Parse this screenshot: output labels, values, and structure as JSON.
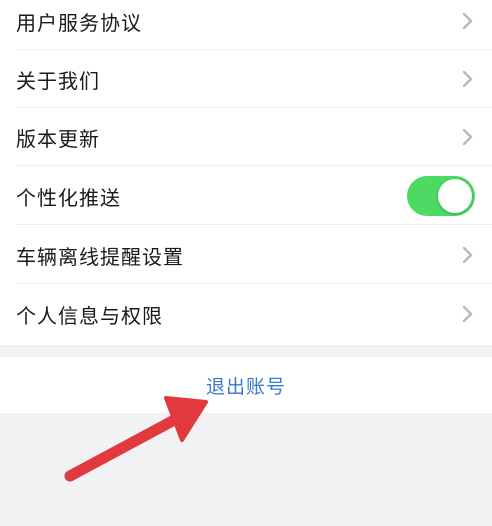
{
  "menu": {
    "items": [
      {
        "label": "用户服务协议",
        "control": "chevron"
      },
      {
        "label": "关于我们",
        "control": "chevron"
      },
      {
        "label": "版本更新",
        "control": "chevron"
      },
      {
        "label": "个性化推送",
        "control": "toggle"
      },
      {
        "label": "车辆离线提醒设置",
        "control": "chevron"
      },
      {
        "label": "个人信息与权限",
        "control": "chevron"
      }
    ]
  },
  "personalized_push": {
    "enabled": true
  },
  "logout": {
    "label": "退出账号"
  },
  "icons": {
    "chevron": "chevron-right-icon",
    "annotation": "red-arrow-icon"
  },
  "colors": {
    "toggle_on": "#4cd964",
    "logout_text": "#3b79c9",
    "annotation_arrow": "#e03a3e"
  }
}
